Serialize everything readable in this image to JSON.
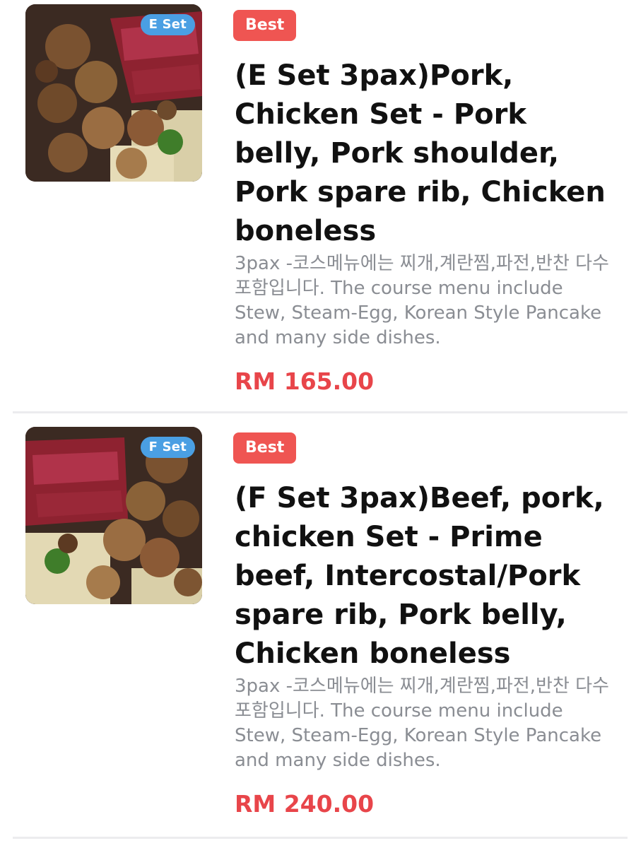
{
  "menu": {
    "items": [
      {
        "set_badge": "E Set",
        "badge": "Best",
        "title": "(E Set 3pax)Pork, Chicken Set - Pork belly, Pork shoulder, Pork spare rib, Chicken boneless",
        "description": "3pax -코스메뉴에는 찌개,계란찜,파전,반찬 다수 포함입니다. The course menu include Stew, Steam-Egg, Korean Style Pancake and many side dishes.",
        "price": "RM 165.00",
        "image": "grilled-pork-chicken-platter"
      },
      {
        "set_badge": "F Set",
        "badge": "Best",
        "title": "(F Set 3pax)Beef, pork, chicken Set - Prime beef, Intercostal/Pork spare rib, Pork belly, Chicken boneless",
        "description": "3pax -코스메뉴에는 찌개,계란찜,파전,반찬 다수 포함입니다. The course menu include Stew, Steam-Egg, Korean Style Pancake and many side dishes.",
        "price": "RM 240.00",
        "image": "grilled-beef-pork-chicken-platter"
      }
    ]
  },
  "colors": {
    "best_badge": "#ef5552",
    "set_badge": "#4a9fe3",
    "price": "#e8454a",
    "title": "#111111",
    "description": "#8a8d93"
  }
}
